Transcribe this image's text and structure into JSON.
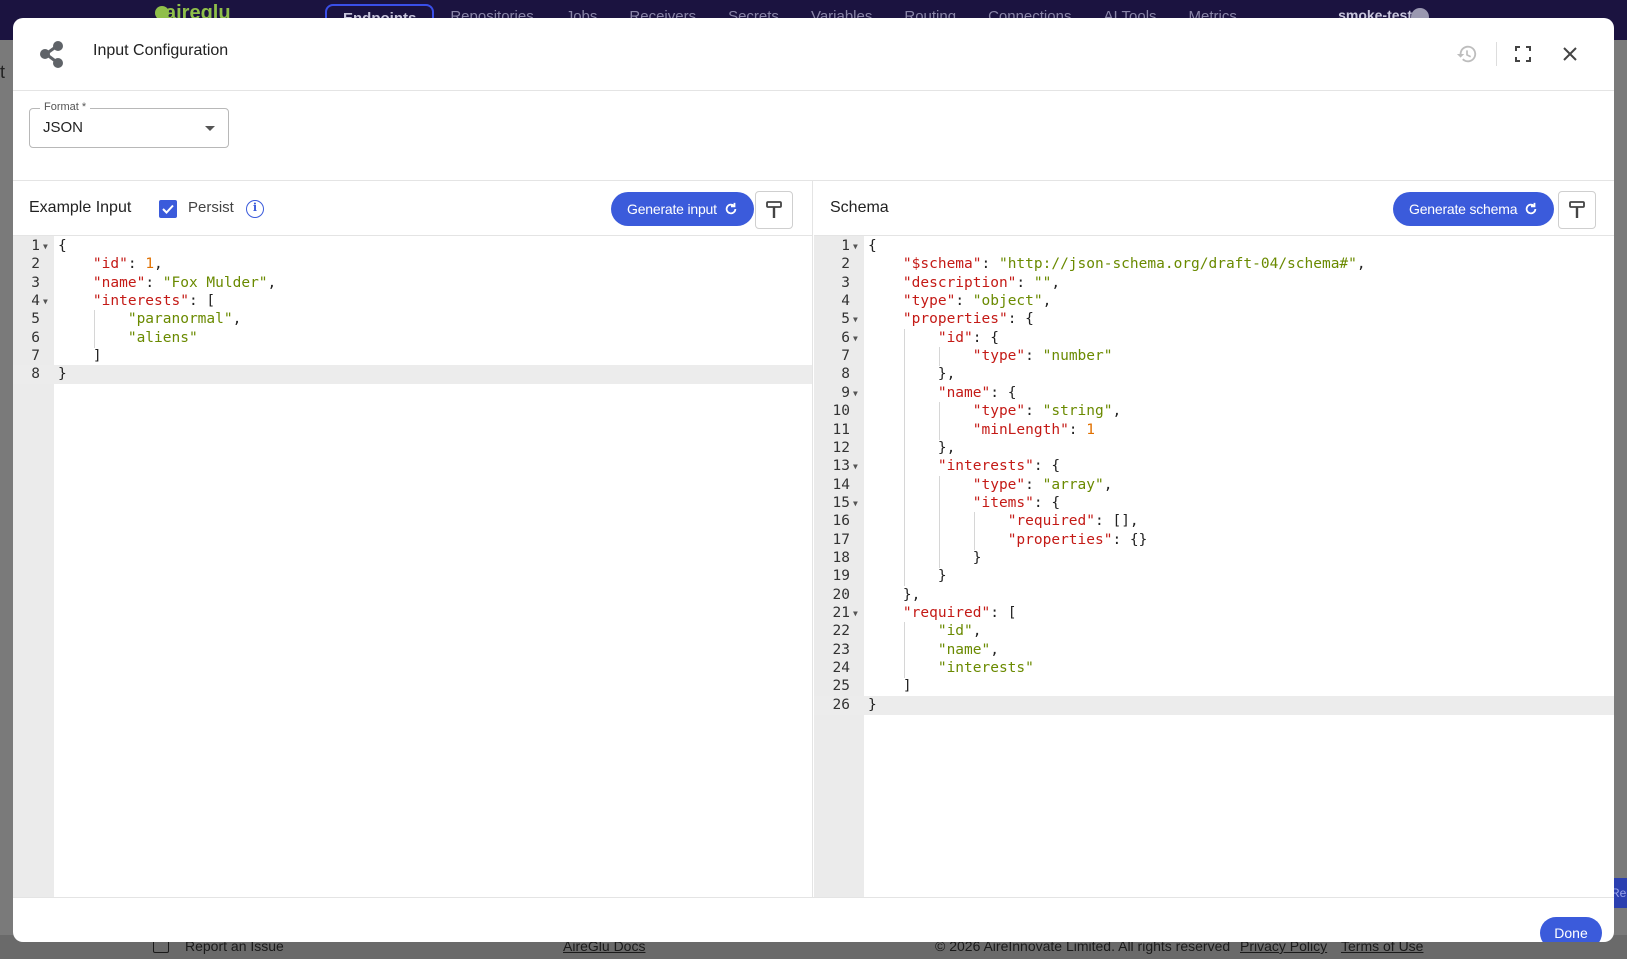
{
  "background": {
    "logo": "aireglu",
    "nav": [
      "Endpoints",
      "Repositories",
      "Jobs",
      "Receivers",
      "Secrets",
      "Variables",
      "Routing",
      "Connections",
      "AI Tools",
      "Metrics"
    ],
    "active_nav": "Endpoints",
    "user": "smoke-test",
    "edge_text": "t",
    "edge_tab": "Re",
    "footer": {
      "report": "Report an Issue",
      "docs": "AireGlu Docs",
      "copyright": "© 2026 AireInnovate Limited. All rights reserved",
      "privacy": "Privacy Policy",
      "terms": "Terms of Use"
    }
  },
  "dialog": {
    "title": "Input Configuration",
    "format": {
      "label": "Format *",
      "value": "JSON"
    },
    "left": {
      "title": "Example Input",
      "persist_label": "Persist",
      "persist_checked": true,
      "generate_label": "Generate input",
      "lines": [
        "{",
        "    \"id\": 1,",
        "    \"name\": \"Fox Mulder\",",
        "    \"interests\": [",
        "        \"paranormal\",",
        "        \"aliens\"",
        "    ]",
        "}"
      ]
    },
    "right": {
      "title": "Schema",
      "generate_label": "Generate schema",
      "lines": [
        "{",
        "    \"$schema\": \"http://json-schema.org/draft-04/schema#\",",
        "    \"description\": \"\",",
        "    \"type\": \"object\",",
        "    \"properties\": {",
        "        \"id\": {",
        "            \"type\": \"number\"",
        "        },",
        "        \"name\": {",
        "            \"type\": \"string\",",
        "            \"minLength\": 1",
        "        },",
        "        \"interests\": {",
        "            \"type\": \"array\",",
        "            \"items\": {",
        "                \"required\": [],",
        "                \"properties\": {}",
        "            }",
        "        }",
        "    },",
        "    \"required\": [",
        "        \"id\",",
        "        \"name\",",
        "        \"interests\"",
        "    ]",
        "}"
      ]
    },
    "done_label": "Done",
    "accent": "#3b5bdb"
  }
}
